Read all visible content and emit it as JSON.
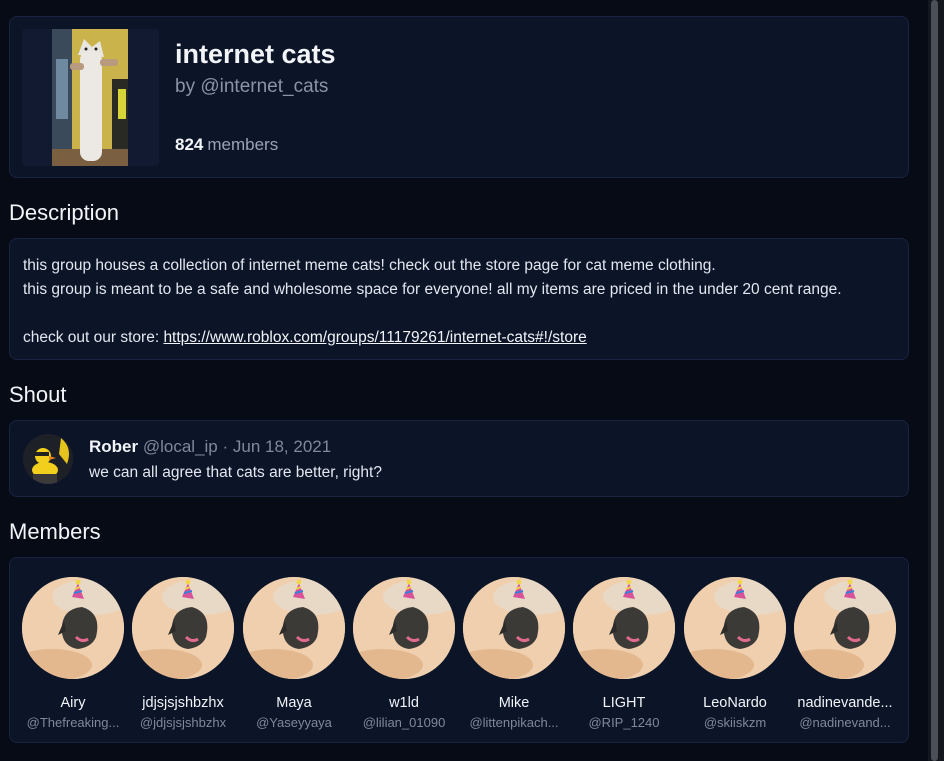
{
  "group": {
    "name": "internet cats",
    "owner": "by @internet_cats",
    "member_count": "824",
    "member_label": "members"
  },
  "description": {
    "heading": "Description",
    "line1": "this group houses a collection of internet meme cats! check out the store page for cat meme clothing.",
    "line2": "this group is meant to be a safe and wholesome space for everyone! all my items are priced in the under 20 cent range.",
    "store_prefix": "check out our store: ",
    "store_link": "https://www.roblox.com/groups/11179261/internet-cats#!/store"
  },
  "shout": {
    "heading": "Shout",
    "author": "Rober",
    "handle": "@local_ip",
    "separator": " · ",
    "date": "Jun 18, 2021",
    "message": "we can all agree that cats are better, right?"
  },
  "members": {
    "heading": "Members",
    "items": [
      {
        "name": "Airy",
        "handle": "@Thefreaking..."
      },
      {
        "name": "jdjsjsjshbzhx",
        "handle": "@jdjsjsjshbzhx"
      },
      {
        "name": "Maya",
        "handle": "@Yaseyyaya"
      },
      {
        "name": "w1ld",
        "handle": "@lilian_01090"
      },
      {
        "name": "Mike",
        "handle": "@littenpikach..."
      },
      {
        "name": "LIGHT",
        "handle": "@RIP_1240"
      },
      {
        "name": "LeoNardo",
        "handle": "@skiiskzm"
      },
      {
        "name": "nadinevande...",
        "handle": "@nadinevand..."
      }
    ]
  }
}
